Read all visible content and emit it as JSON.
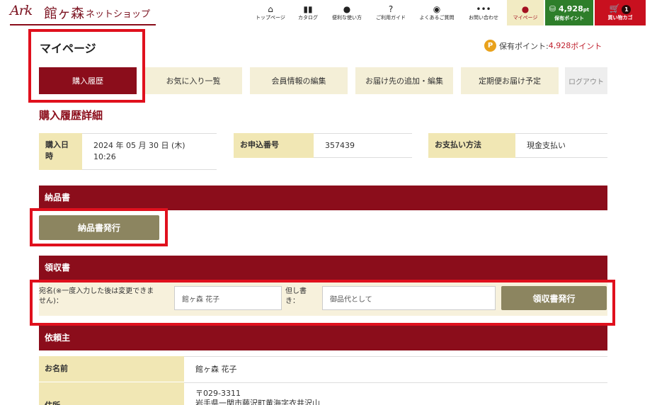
{
  "header": {
    "logo_mark": "Ark",
    "logo_kanji": "館ヶ森",
    "logo_sub": "ネットショップ",
    "nav": [
      {
        "icon": "home-icon",
        "glyph": "⌂",
        "label": "トップページ"
      },
      {
        "icon": "book-icon",
        "glyph": "▮▮",
        "label": "カタログ"
      },
      {
        "icon": "lightbulb-icon",
        "glyph": "●",
        "label": "便利な使い方"
      },
      {
        "icon": "question-icon",
        "glyph": "?",
        "label": "ご利用ガイド"
      },
      {
        "icon": "chat-bubbles-icon",
        "glyph": "◉",
        "label": "よくあるご質問"
      },
      {
        "icon": "message-icon",
        "glyph": "•••",
        "label": "お問い合わせ"
      }
    ],
    "mypage": {
      "glyph": "●",
      "label": "マイページ"
    },
    "points": {
      "value": "4,928",
      "unit": "pt",
      "label": "保有ポイント"
    },
    "cart": {
      "glyph": "🛒",
      "count": "1",
      "label": "買い物カゴ"
    }
  },
  "page": {
    "title": "マイページ",
    "points_prefix": "保有ポイント: ",
    "points_value": "4,928",
    "points_suffix": "ポイント",
    "points_badge": "P"
  },
  "tabs": [
    {
      "label": "購入履歴"
    },
    {
      "label": "お気に入り一覧"
    },
    {
      "label": "会員情報の編集"
    },
    {
      "label": "お届け先の追加・編集"
    },
    {
      "label": "定期便お届け予定"
    },
    {
      "label": "ログアウト"
    }
  ],
  "detail": {
    "title": "購入履歴詳細",
    "purchase_date_label": "購入日時",
    "purchase_date_line1": "2024 年 05 月 30 日 (木)",
    "purchase_date_line2": "10:26",
    "order_no_label": "お申込番号",
    "order_no": "357439",
    "payment_label": "お支払い方法",
    "payment": "現金支払い"
  },
  "invoice": {
    "title": "納品書",
    "button": "納品書発行"
  },
  "receipt": {
    "title": "領収書",
    "addressee_label_line1": "宛名(※一度入力した後は変更できま",
    "addressee_label_line2": "せん)：",
    "addressee_value": "館ヶ森 花子",
    "proviso_label_line1": "但し書",
    "proviso_label_line2": "き：",
    "proviso_value": "御品代として",
    "button": "領収書発行"
  },
  "requester": {
    "title": "依頼主",
    "name_label": "お名前",
    "name": "館ヶ森 花子",
    "address_label": "住所",
    "postal": "〒029-3311",
    "address": "岩手県一関市藤沢町黄海字衣井沢山"
  }
}
